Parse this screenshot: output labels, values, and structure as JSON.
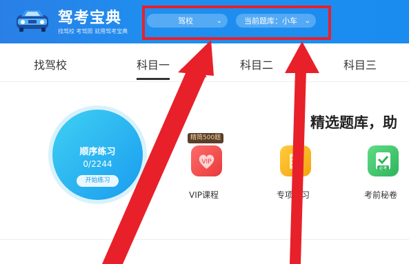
{
  "header": {
    "app_name": "驾考宝典",
    "tagline": "找驾校 考驾照 就用驾考宝典",
    "school_selector": {
      "label": "驾校"
    },
    "bank_selector": {
      "label": "当前题库：小车"
    }
  },
  "tabs": [
    {
      "label": "找驾校"
    },
    {
      "label": "科目一"
    },
    {
      "label": "科目二"
    },
    {
      "label": "科目三"
    }
  ],
  "practice": {
    "title": "顺序练习",
    "progress": "0/2244",
    "button": "开始练习"
  },
  "headline": "精选题库，助",
  "features": [
    {
      "label": "VIP课程",
      "icon_text": "VIP",
      "badge": "精简500题"
    },
    {
      "label": "专项练习"
    },
    {
      "label": "考前秘卷",
      "icon_text": "必考"
    }
  ],
  "colors": {
    "header_blue": "#1e8ff0",
    "highlight_red": "#e8202a",
    "circle_cyan": "#3fd0f2",
    "vip_red": "#f0504f",
    "special_orange": "#f6b21d",
    "exam_green": "#3cc76a"
  }
}
